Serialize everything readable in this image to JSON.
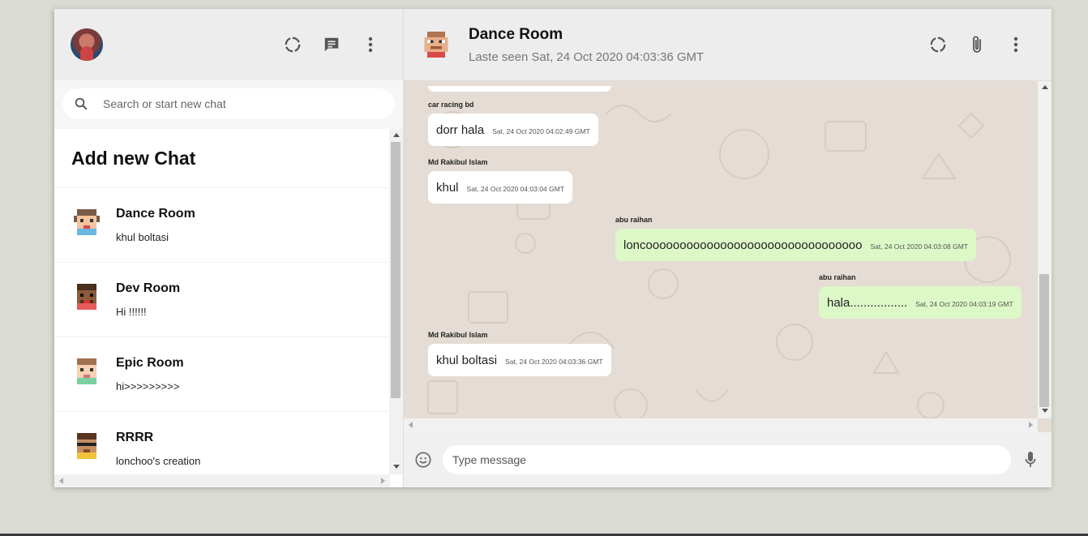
{
  "sidebar": {
    "search_placeholder": "Search or start new chat",
    "add_chat_label": "Add new Chat",
    "chats": [
      {
        "name": "Dance Room",
        "last_message": "khul boltasi",
        "icon": "pixel-avatar-orange"
      },
      {
        "name": "Dev Room",
        "last_message": "Hi !!!!!!",
        "icon": "pixel-avatar-brown"
      },
      {
        "name": "Epic Room",
        "last_message": "hi>>>>>>>>>",
        "icon": "pixel-avatar-green"
      },
      {
        "name": "RRRR",
        "last_message": "lonchoo's creation",
        "icon": "pixel-avatar-glasses"
      }
    ]
  },
  "chat": {
    "room_name": "Dance Room",
    "last_seen": "Laste seen Sat, 24 Oct 2020 04:03:36 GMT",
    "input_placeholder": "Type message",
    "messages": [
      {
        "sender": "car racing bd",
        "text": "dorr hala",
        "time": "Sat, 24 Oct 2020 04:02:49 GMT",
        "mine": false
      },
      {
        "sender": "Md Rakibul Islam",
        "text": "khul",
        "time": "Sat, 24 Oct 2020 04:03:04 GMT",
        "mine": false
      },
      {
        "sender": "abu raihan",
        "text": "loncoooooooooooooooooooooooooooooooo",
        "time": "Sat, 24 Oct 2020 04:03:08 GMT",
        "mine": true
      },
      {
        "sender": "abu raihan",
        "text": "hala.................",
        "time": "Sat, 24 Oct 2020 04:03:19 GMT",
        "mine": true
      },
      {
        "sender": "Md Rakibul Islam",
        "text": "khul boltasi",
        "time": "Sat, 24 Oct 2020 04:03:36 GMT",
        "mine": false
      }
    ]
  },
  "colors": {
    "background": "#dadbd3",
    "header": "#ededed",
    "chat_bg": "#e5ddd5",
    "my_bubble": "#dcf8c6",
    "other_bubble": "#ffffff"
  }
}
